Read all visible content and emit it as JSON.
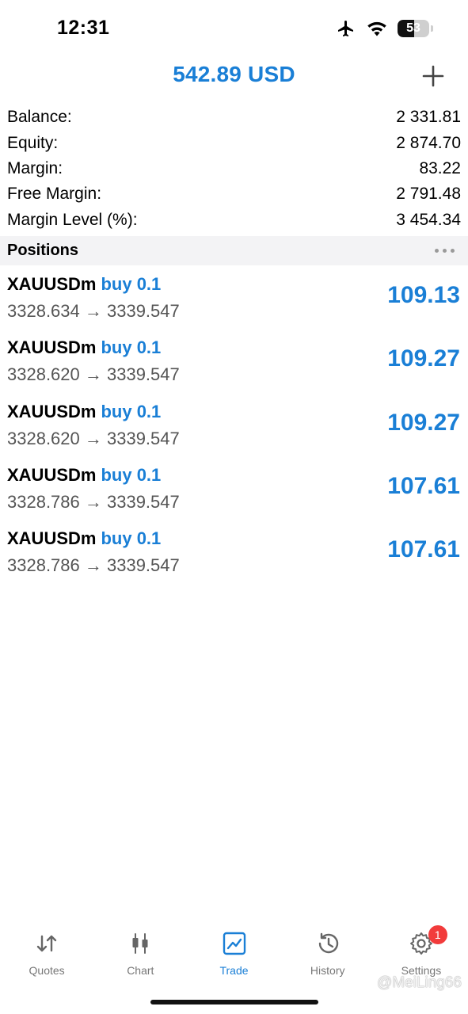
{
  "status_bar": {
    "time": "12:31",
    "battery_level": "53",
    "icons": [
      "airplane-icon",
      "wifi-icon",
      "battery-icon"
    ]
  },
  "header": {
    "title": "542.89 USD",
    "add_icon": "plus-icon"
  },
  "summary": [
    {
      "label": "Balance:",
      "value": "2 331.81"
    },
    {
      "label": "Equity:",
      "value": "2 874.70"
    },
    {
      "label": "Margin:",
      "value": "83.22"
    },
    {
      "label": "Free Margin:",
      "value": "2 791.48"
    },
    {
      "label": "Margin Level (%):",
      "value": "3 454.34"
    }
  ],
  "positions": {
    "title": "Positions",
    "items": [
      {
        "symbol": "XAUUSDm",
        "side": "buy 0.1",
        "prices": "3328.634 → 3339.547",
        "profit": "109.13"
      },
      {
        "symbol": "XAUUSDm",
        "side": "buy 0.1",
        "prices": "3328.620 → 3339.547",
        "profit": "109.27"
      },
      {
        "symbol": "XAUUSDm",
        "side": "buy 0.1",
        "prices": "3328.620 → 3339.547",
        "profit": "109.27"
      },
      {
        "symbol": "XAUUSDm",
        "side": "buy 0.1",
        "prices": "3328.786 → 3339.547",
        "profit": "107.61"
      },
      {
        "symbol": "XAUUSDm",
        "side": "buy 0.1",
        "prices": "3328.786 → 3339.547",
        "profit": "107.61"
      }
    ]
  },
  "tabbar": {
    "tabs": [
      {
        "label": "Quotes",
        "icon": "quotes-arrows-icon"
      },
      {
        "label": "Chart",
        "icon": "candlestick-icon"
      },
      {
        "label": "Trade",
        "icon": "trade-chart-icon",
        "active": true
      },
      {
        "label": "History",
        "icon": "history-clock-icon"
      },
      {
        "label": "Settings",
        "icon": "gear-icon",
        "badge": "1"
      }
    ]
  },
  "watermark": "@MeiLing66",
  "colors": {
    "accent": "#1a7fd6",
    "badge": "#f23b3b",
    "section_bg": "#f3f3f5",
    "secondary_text": "#555555"
  }
}
